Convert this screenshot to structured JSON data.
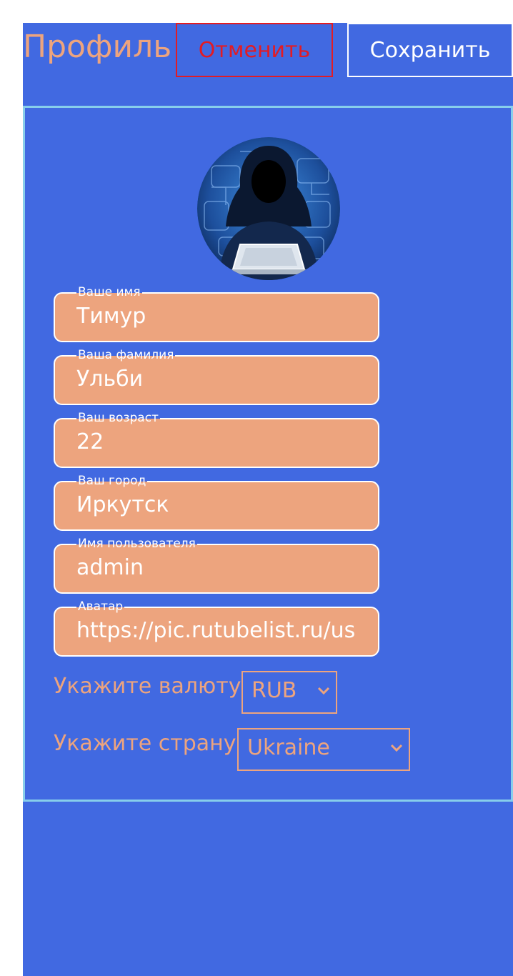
{
  "header": {
    "title": "Профиль",
    "cancel_label": "Отменить",
    "save_label": "Сохранить"
  },
  "profile": {
    "avatar_icon": "hacker-avatar-icon",
    "fields": [
      {
        "label": "Ваше имя",
        "value": "Тимур"
      },
      {
        "label": "Ваша фамилия",
        "value": "Ульби"
      },
      {
        "label": "Ваш возраст",
        "value": "22"
      },
      {
        "label": "Ваш город",
        "value": "Иркутск"
      },
      {
        "label": "Имя пользователя",
        "value": "admin"
      },
      {
        "label": "Аватар",
        "value": "https://pic.rutubelist.ru/us"
      }
    ],
    "currency": {
      "label": "Укажите валюту",
      "selected": "RUB"
    },
    "country": {
      "label": "Укажите страну",
      "selected": "Ukraine"
    }
  },
  "colors": {
    "background": "#4169e1",
    "accent": "#eda47e",
    "cancel": "#e31b23",
    "card_border": "#87ceeb"
  }
}
